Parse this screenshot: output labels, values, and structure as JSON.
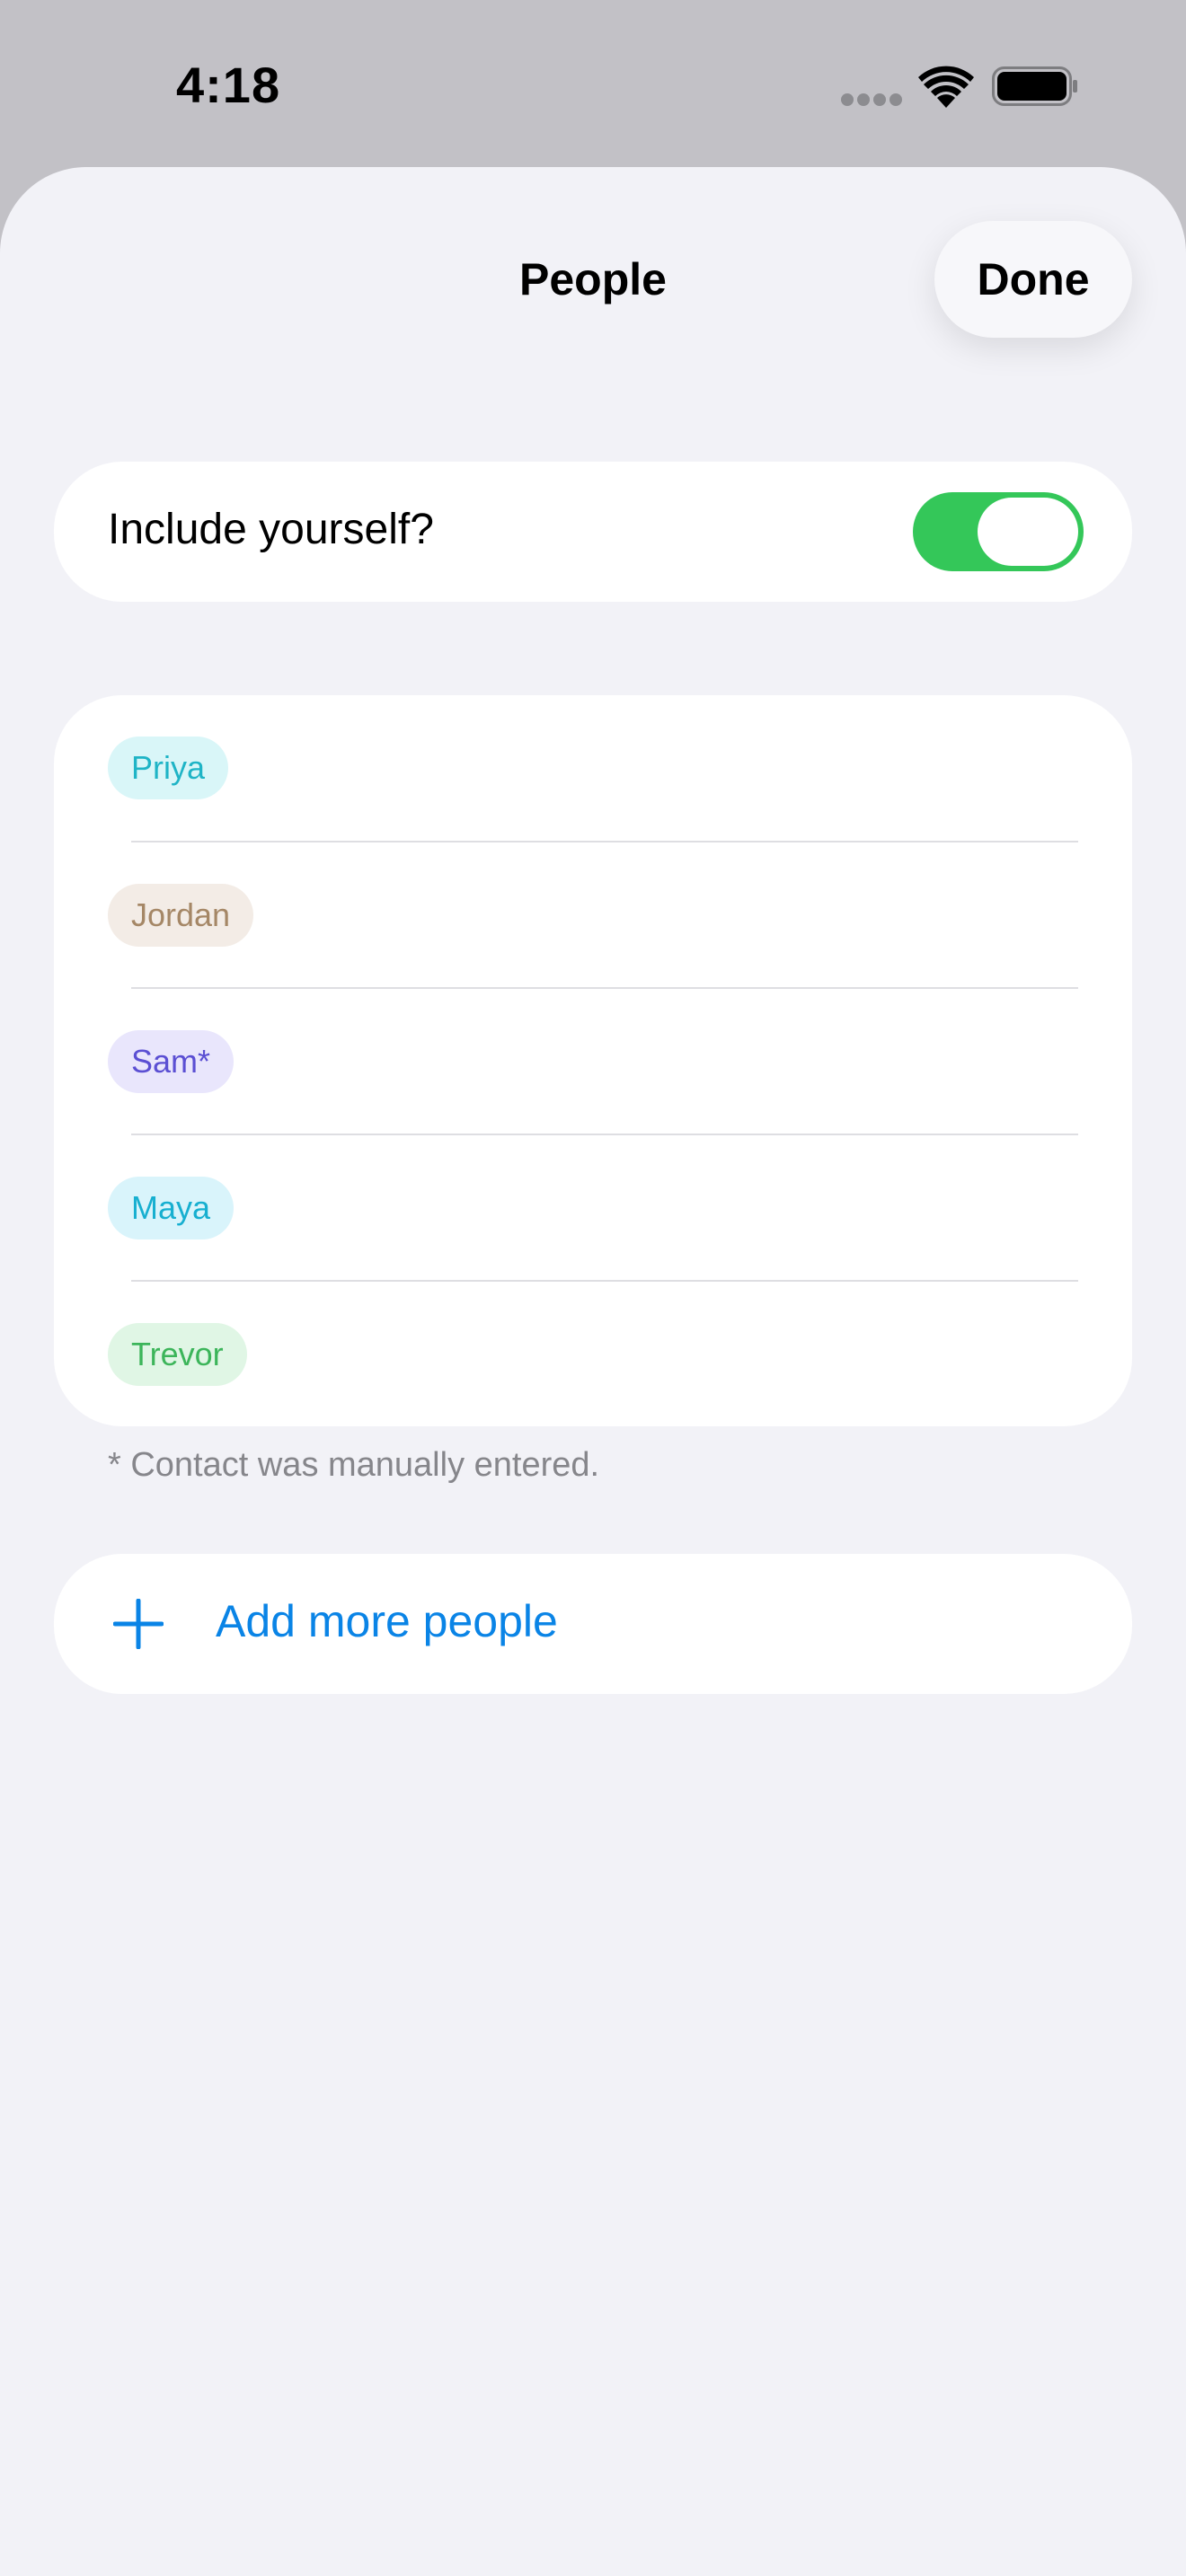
{
  "status_bar": {
    "time": "4:18"
  },
  "sheet": {
    "title": "People",
    "done_label": "Done"
  },
  "include_yourself": {
    "label": "Include yourself?",
    "enabled": true
  },
  "people": [
    {
      "name": "Priya",
      "chip_bg": "#d9f6f8",
      "chip_fg": "#1fb4c6"
    },
    {
      "name": "Jordan",
      "chip_bg": "#f3ece6",
      "chip_fg": "#a58766"
    },
    {
      "name": "Sam*",
      "chip_bg": "#e9e6fc",
      "chip_fg": "#5b4fd3"
    },
    {
      "name": "Maya",
      "chip_bg": "#d9f4fb",
      "chip_fg": "#17afd0"
    },
    {
      "name": "Trevor",
      "chip_bg": "#e0f6e5",
      "chip_fg": "#3cb55a"
    }
  ],
  "footnote": "* Contact was manually entered.",
  "add_more": {
    "label": "Add more people",
    "icon": "plus-icon"
  },
  "colors": {
    "accent": "#0a84e6",
    "toggle_on": "#34c759"
  }
}
